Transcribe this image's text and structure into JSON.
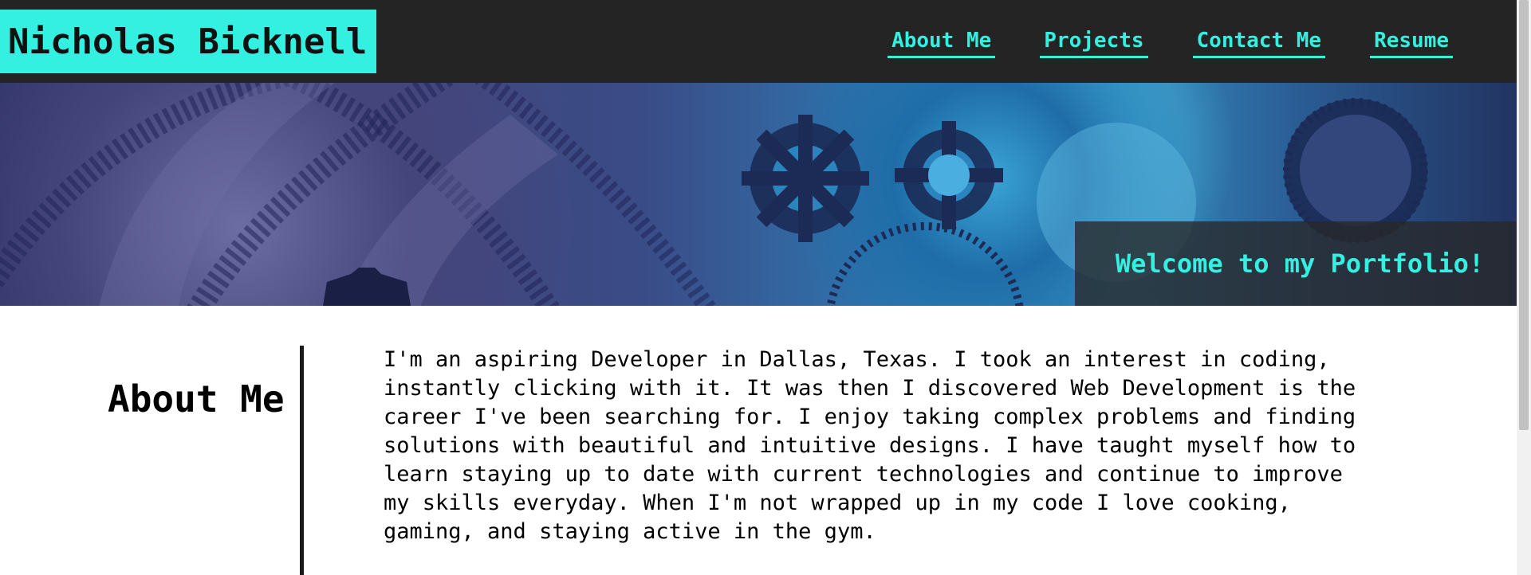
{
  "header": {
    "brand": "Nicholas Bicknell",
    "nav": [
      {
        "label": "About Me"
      },
      {
        "label": "Projects"
      },
      {
        "label": "Contact Me"
      },
      {
        "label": "Resume"
      }
    ]
  },
  "hero": {
    "caption": "Welcome to my Portfolio!",
    "image": "gears-background"
  },
  "about": {
    "heading": "About Me",
    "lines": [
      "I'm an aspiring Developer in Dallas, Texas. I took an interest in coding,",
      "instantly clicking with it. It was then I discovered Web Development is the",
      "career I've been searching for. I enjoy taking complex problems and finding",
      "solutions with beautiful and intuitive designs. I have taught myself how to",
      "learn staying up to date with current technologies and continue to improve",
      "my skills everyday. When I'm not wrapped up in my code I love cooking,",
      "gaming, and staying active in the gym."
    ]
  },
  "colors": {
    "accent": "#33f0e0",
    "header_bg": "#242424",
    "caption_bg": "#282828"
  }
}
